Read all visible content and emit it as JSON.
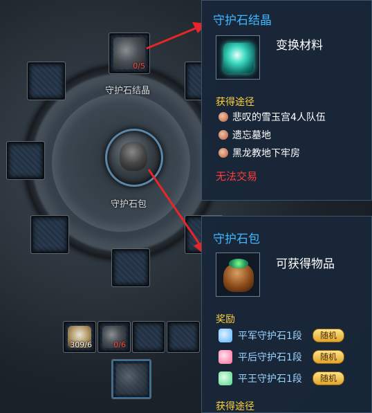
{
  "crystal_slot": {
    "label": "守护石结晶",
    "count": "0/5"
  },
  "bag_slot": {
    "label": "守护石包"
  },
  "inventory": {
    "slot1_count": "309/6",
    "slot2_count": "0/6"
  },
  "tooltip_crystal": {
    "title": "守护石结晶",
    "description": "变换材料",
    "section": "获得途径",
    "sources": [
      "悲叹的雪玉宫4人队伍",
      "遗忘墓地",
      "黑龙教地下牢房"
    ],
    "trade_status": "无法交易"
  },
  "tooltip_bag": {
    "title": "守护石包",
    "description": "可获得物品",
    "reward_section": "奖励",
    "rewards": [
      {
        "name": "平军守护石1段",
        "badge": "随机",
        "color": "#59b4ff"
      },
      {
        "name": "平后守护石1段",
        "badge": "随机",
        "color": "#ff6a9a"
      },
      {
        "name": "平王守护石1段",
        "badge": "随机",
        "color": "#4fd48a"
      }
    ],
    "source_section": "获得途径"
  },
  "colors": {
    "title_blue": "#3fb8ff",
    "section_gold": "#ffd23a",
    "warn_red": "#ff3c3c",
    "arrow_red": "#e8262a"
  }
}
